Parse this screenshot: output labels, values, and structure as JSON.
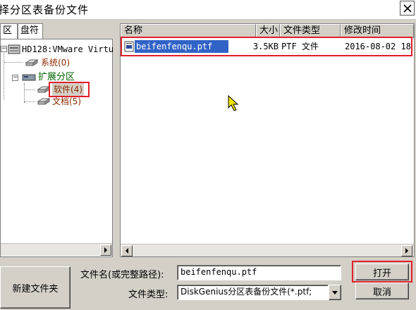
{
  "dialog": {
    "title": "择分区表备份文件"
  },
  "tabs": [
    "区",
    "盘符"
  ],
  "tree": {
    "disk": "HD128:VMware Virtu",
    "items": [
      {
        "label": "系统(0)"
      },
      {
        "label": "扩展分区"
      },
      {
        "label": "软件(4)"
      },
      {
        "label": "文档(5)"
      }
    ]
  },
  "columns": [
    "名称",
    "大小",
    "文件类型",
    "修改时间"
  ],
  "files": [
    {
      "name": "beifenfenqu.ptf",
      "size": "3.5KB",
      "type": "PTF 文件",
      "modified": "2016-08-02 18"
    }
  ],
  "form": {
    "filename_label": "文件名(或完整路径):",
    "filename_value": "beifenfenqu.ptf",
    "filetype_label": "文件类型:",
    "filetype_value": "DiskGenius分区表备份文件(*.ptf;"
  },
  "buttons": {
    "new_folder": "新建文件夹",
    "open": "打开",
    "cancel": "取消"
  },
  "colors": {
    "selection": "#3163c6",
    "highlight_box": "#e0202a",
    "partition_text": "#8a2a00",
    "extended_text": "#006400"
  },
  "icons": [
    "close-icon",
    "disk-icon",
    "partition-icon",
    "file-icon",
    "scroll-left-icon",
    "scroll-right-icon",
    "dropdown-arrow-icon",
    "mouse-cursor-icon"
  ]
}
